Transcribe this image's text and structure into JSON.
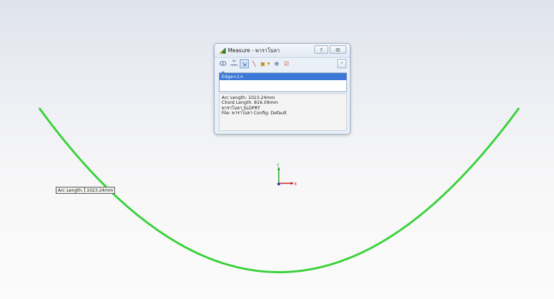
{
  "dialog": {
    "title": "Measure - พาราโบลา",
    "help_label": "?",
    "close_label": "☒",
    "toolbar": {
      "tools": [
        "ↀ ▾",
        "in\nmm",
        "⇲",
        "╲",
        "▣ ▾",
        "⊕",
        "☑"
      ],
      "collapse_label": "⌃"
    },
    "selection": {
      "items": [
        "Edge<1>"
      ]
    },
    "results": [
      "Arc Length: 1023.24mm",
      "Chord Length: 816.09mm",
      "พาราโบลา.SLDPRT",
      "File: พาราโบลา Config: Default"
    ]
  },
  "tooltip": {
    "label": "Arc Length:",
    "value": "1023.24mm"
  },
  "triad": {
    "y_label": "Y",
    "x_label": "X"
  },
  "colors": {
    "curve": "#3ad23a",
    "selection": "#3b78d8",
    "axis_x": "#cc2222",
    "axis_y": "#2ca02c",
    "axis_z": "#2244cc"
  }
}
